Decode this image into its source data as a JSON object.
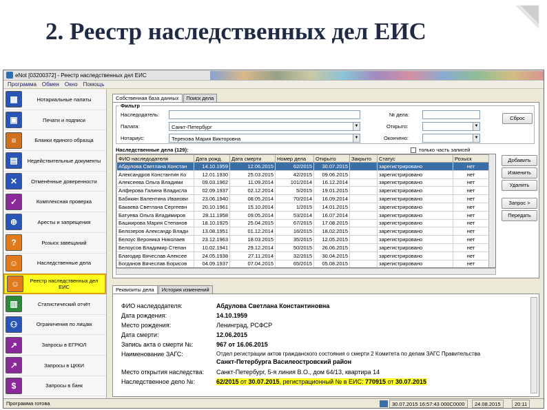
{
  "slide": {
    "title": "2. Реестр наследственных дел ЕИС"
  },
  "window": {
    "title": "eNot [03200372] - Реестр наследственных дел ЕИС"
  },
  "menu": [
    "Программа",
    "Обмен",
    "Окно",
    "Помощь"
  ],
  "nav": [
    {
      "label": "Нотариальные палаты",
      "icon": "building-icon",
      "color": "#2a55b8"
    },
    {
      "label": "Печати и подписи",
      "icon": "stamp-icon",
      "color": "#2a55b8"
    },
    {
      "label": "Бланки единого образца",
      "icon": "form-icon",
      "color": "#d0701c"
    },
    {
      "label": "Недействительные документы",
      "icon": "invalid-doc-icon",
      "color": "#2a55b8"
    },
    {
      "label": "Отменённые доверенности",
      "icon": "cancelled-icon",
      "color": "#2a55b8"
    },
    {
      "label": "Комплексная проверка",
      "icon": "check-icon",
      "color": "#8a2a9a"
    },
    {
      "label": "Аресты и запрещения",
      "icon": "arrest-icon",
      "color": "#2a55b8"
    },
    {
      "label": "Розыск завещаний",
      "icon": "search-icon",
      "color": "#e07a1c"
    },
    {
      "label": "Наследственные дела",
      "icon": "person-icon",
      "color": "#e07a1c"
    },
    {
      "label": "Реестр наследственных дел ЕИС",
      "icon": "registry-icon",
      "color": "#e07a1c",
      "selected": true
    },
    {
      "label": "Статистический отчёт",
      "icon": "chart-icon",
      "color": "#2a8a3a"
    },
    {
      "label": "Ограничения по лицам",
      "icon": "people-icon",
      "color": "#2a55b8"
    },
    {
      "label": "Запросы в ЕГРЮЛ",
      "icon": "request-icon",
      "color": "#8a2a9a"
    },
    {
      "label": "Запросы в ЦККИ",
      "icon": "request-icon",
      "color": "#8a2a9a"
    },
    {
      "label": "Запросы в банк",
      "icon": "bank-icon",
      "color": "#8a2a9a"
    }
  ],
  "tabs": {
    "t1": "Собственная база данных",
    "t2": "Поиск дела"
  },
  "filter": {
    "title": "Фильтр",
    "heir_label": "Наследодатель:",
    "heir_value": "",
    "chamber_label": "Палата:",
    "chamber_value": "Санкт-Петербург",
    "notary_label": "Нотариус:",
    "notary_value": "Терехова Мария Викторовна",
    "case_label": "№ дела:",
    "case_value": "",
    "opened_label": "Открыто:",
    "opened_value": "",
    "closed_label": "Окончено:",
    "closed_value": "",
    "reset_button": "Сброс"
  },
  "list": {
    "caption": "Наследственные дела (129):",
    "partial_label": "только часть записей"
  },
  "table": {
    "columns": [
      "ФИО наследодателя",
      "Дата рожд.",
      "Дата смерти",
      "Номер дела",
      "Открыто",
      "Закрыто",
      "Статус",
      "Розыск"
    ],
    "rows": [
      [
        "Абдулова Светлана Констан",
        "14.10.1959",
        "12.06.2015",
        "62/2015",
        "30.07.2015",
        "",
        "зарегистрировано",
        "нет"
      ],
      [
        "Александров Константин Ко",
        "12.01.1930",
        "25.03.2015",
        "42/2015",
        "09.06.2015",
        "",
        "зарегистрировано",
        "нет"
      ],
      [
        "Алексеева Ольга Владими",
        "09.03.1962",
        "11.09.2014",
        "101/2014",
        "16.12.2014",
        "",
        "зарегистрировано",
        "нет"
      ],
      [
        "Алферова Галина Владисла",
        "02.09.1937",
        "02.12.2014",
        "5/2015",
        "19.01.2015",
        "",
        "зарегистрировано",
        "нет"
      ],
      [
        "Бабикян Валентина Иванови",
        "23.06.1940",
        "08.05.2014",
        "70/2014",
        "16.09.2014",
        "",
        "зарегистрировано",
        "нет"
      ],
      [
        "Бакаева Светлана Сергеевн",
        "20.10.1961",
        "15.10.2014",
        "1/2015",
        "14.01.2015",
        "",
        "зарегистрировано",
        "нет"
      ],
      [
        "Батуева Ольга Владимиров",
        "28.11.1958",
        "09.05.2014",
        "53/2014",
        "16.07.2014",
        "",
        "зарегистрировано",
        "нет"
      ],
      [
        "Башкирова Мария Степанов",
        "18.10.1925",
        "25.04.2015",
        "67/2015",
        "17.08.2015",
        "",
        "зарегистрировано",
        "нет"
      ],
      [
        "Белозеров Александр Влади",
        "13.08.1951",
        "01.12.2014",
        "16/2015",
        "18.02.2015",
        "",
        "зарегистрировано",
        "нет"
      ],
      [
        "Белоус Вероника Николаев",
        "23.12.1963",
        "18.03.2015",
        "35/2015",
        "12.05.2015",
        "",
        "зарегистрировано",
        "нет"
      ],
      [
        "Белоусов Владимир Степан",
        "10.02.1941",
        "29.12.2014",
        "50/2015",
        "26.06.2015",
        "",
        "зарегистрировано",
        "нет"
      ],
      [
        "Благодир Вячеслав Алексее",
        "24.05.1938",
        "27.11.2014",
        "32/2015",
        "30.04.2015",
        "",
        "зарегистрировано",
        "нет"
      ],
      [
        "Богданов Вячеслав Борисов",
        "04.09.1937",
        "07.04.2015",
        "65/2015",
        "05.08.2015",
        "",
        "зарегистрировано",
        "нет"
      ]
    ]
  },
  "actions": {
    "add": "Добавить",
    "edit": "Изменить",
    "delete": "Удалить",
    "request": "Запрос >",
    "transfer": "Передать"
  },
  "tabs2": {
    "t1": "Реквизиты дела",
    "t2": "История изменений"
  },
  "details": {
    "fio_label": "ФИО наследодателя:",
    "fio": "Абдулова Светлана Константиновна",
    "birth_label": "Дата рождения:",
    "birth": "14.10.1959",
    "birthplace_label": "Место рождения:",
    "birthplace": "Ленинград, РСФСР",
    "death_label": "Дата смерти:",
    "death": "12.06.2015",
    "act_label": "Запись акта о смерти №:",
    "act": "967 от 16.06.2015",
    "zags_label": "Наименование ЗАГС:",
    "zags_line1": "Отдел регистрации актов гражданского состояния о смерти 2 Комитета по делам ЗАГС Правительства",
    "zags_line2": "Санкт-Петербурга Василеостровский район",
    "place_label": "Место открытия наследства:",
    "place": "Санкт-Петербург, 5-я линия В.О., дом 64/13, квартира 14",
    "case_label": "Наследственное дело №:",
    "case_num": "62/2015",
    "case_from": " от ",
    "case_date": "30.07.2015",
    "case_reg": ", регистрационный № в ЕИС: ",
    "case_eis": "770915",
    "case_from2": " от ",
    "case_eis_date": "30.07.2015"
  },
  "status": {
    "ready": "Программа готова",
    "sync": "30.07.2015 16:57:43 000C0000",
    "date": "24.08.2015",
    "time": "20:11"
  }
}
